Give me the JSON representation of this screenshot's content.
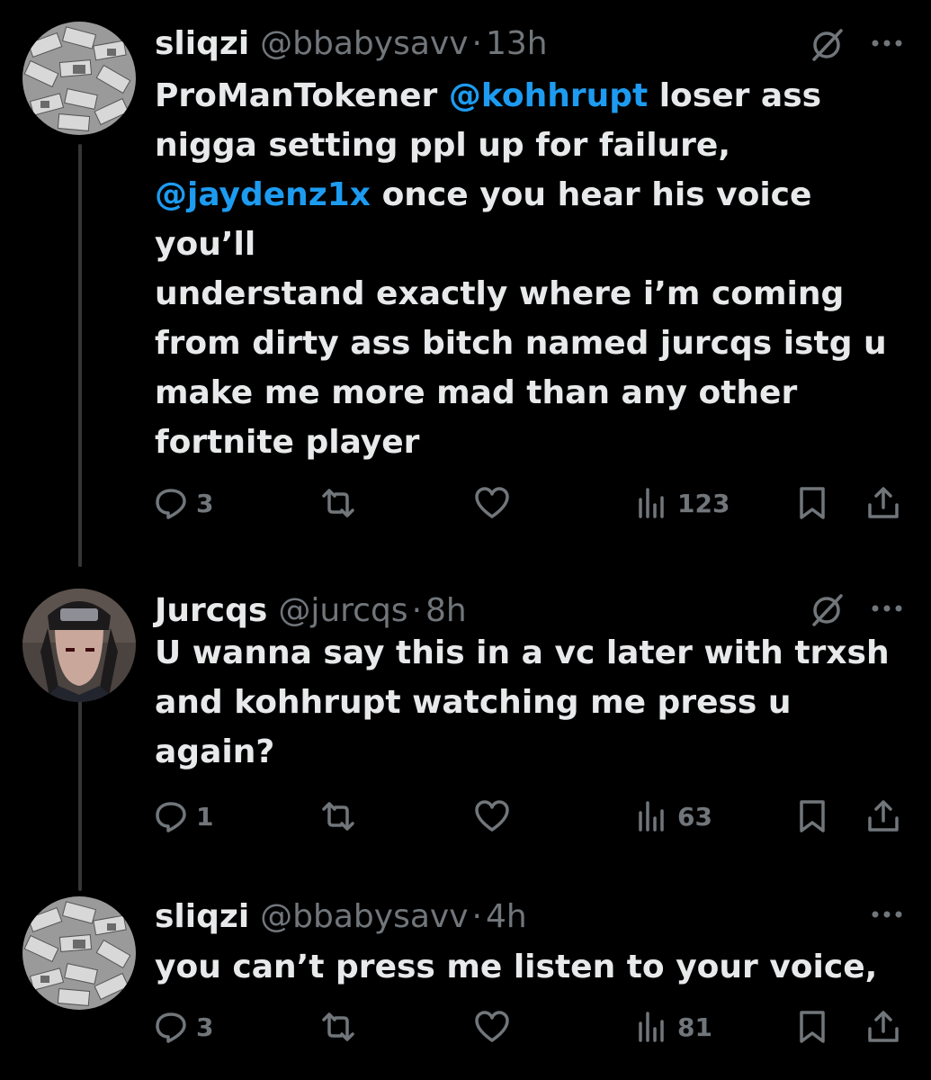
{
  "tweets": [
    {
      "name": "sliqzi",
      "handle": "@bbabysavv",
      "separator": "·",
      "time": "13h",
      "lines": [
        [
          {
            "t": "ProManTokener "
          },
          {
            "t": "@kohhrupt",
            "m": true
          },
          {
            "t": " loser ass"
          }
        ],
        [
          {
            "t": "nigga setting ppl up for failure,"
          }
        ],
        [
          {
            "t": "@jaydenz1x",
            "m": true
          },
          {
            "t": " once you hear his voice"
          }
        ],
        [
          {
            "t": "you’ll"
          }
        ],
        [
          {
            "t": "understand exactly where i’m coming"
          }
        ],
        [
          {
            "t": "from dirty ass bitch named jurcqs istg u"
          }
        ],
        [
          {
            "t": "make me more mad than any other"
          }
        ],
        [
          {
            "t": "fortnite player"
          }
        ]
      ],
      "replies": "3",
      "retweets": "",
      "likes": "",
      "views": "123"
    },
    {
      "name": "Jurcqs",
      "handle": "@jurcqs",
      "separator": "·",
      "time": "8h",
      "lines": [
        [
          {
            "t": "U wanna say this in a vc later with trxsh"
          }
        ],
        [
          {
            "t": "and kohhrupt watching me press u"
          }
        ],
        [
          {
            "t": "again?"
          }
        ]
      ],
      "replies": "1",
      "retweets": "",
      "likes": "",
      "views": "63"
    },
    {
      "name": "sliqzi",
      "handle": "@bbabysavv",
      "separator": "·",
      "time": "4h",
      "lines": [
        [
          {
            "t": "you can’t press me listen to your voice,"
          }
        ]
      ],
      "replies": "3",
      "retweets": "",
      "likes": "",
      "views": "81"
    }
  ],
  "icons": {
    "reply": "reply-icon",
    "retweet": "retweet-icon",
    "like": "heart-icon",
    "views": "views-icon",
    "bookmark": "bookmark-icon",
    "share": "share-icon",
    "grok": "grok-icon",
    "more": "more-icon"
  },
  "colors": {
    "background": "#000000",
    "text": "#e7e9ea",
    "muted": "#71767b",
    "mention": "#1d9bf0"
  }
}
